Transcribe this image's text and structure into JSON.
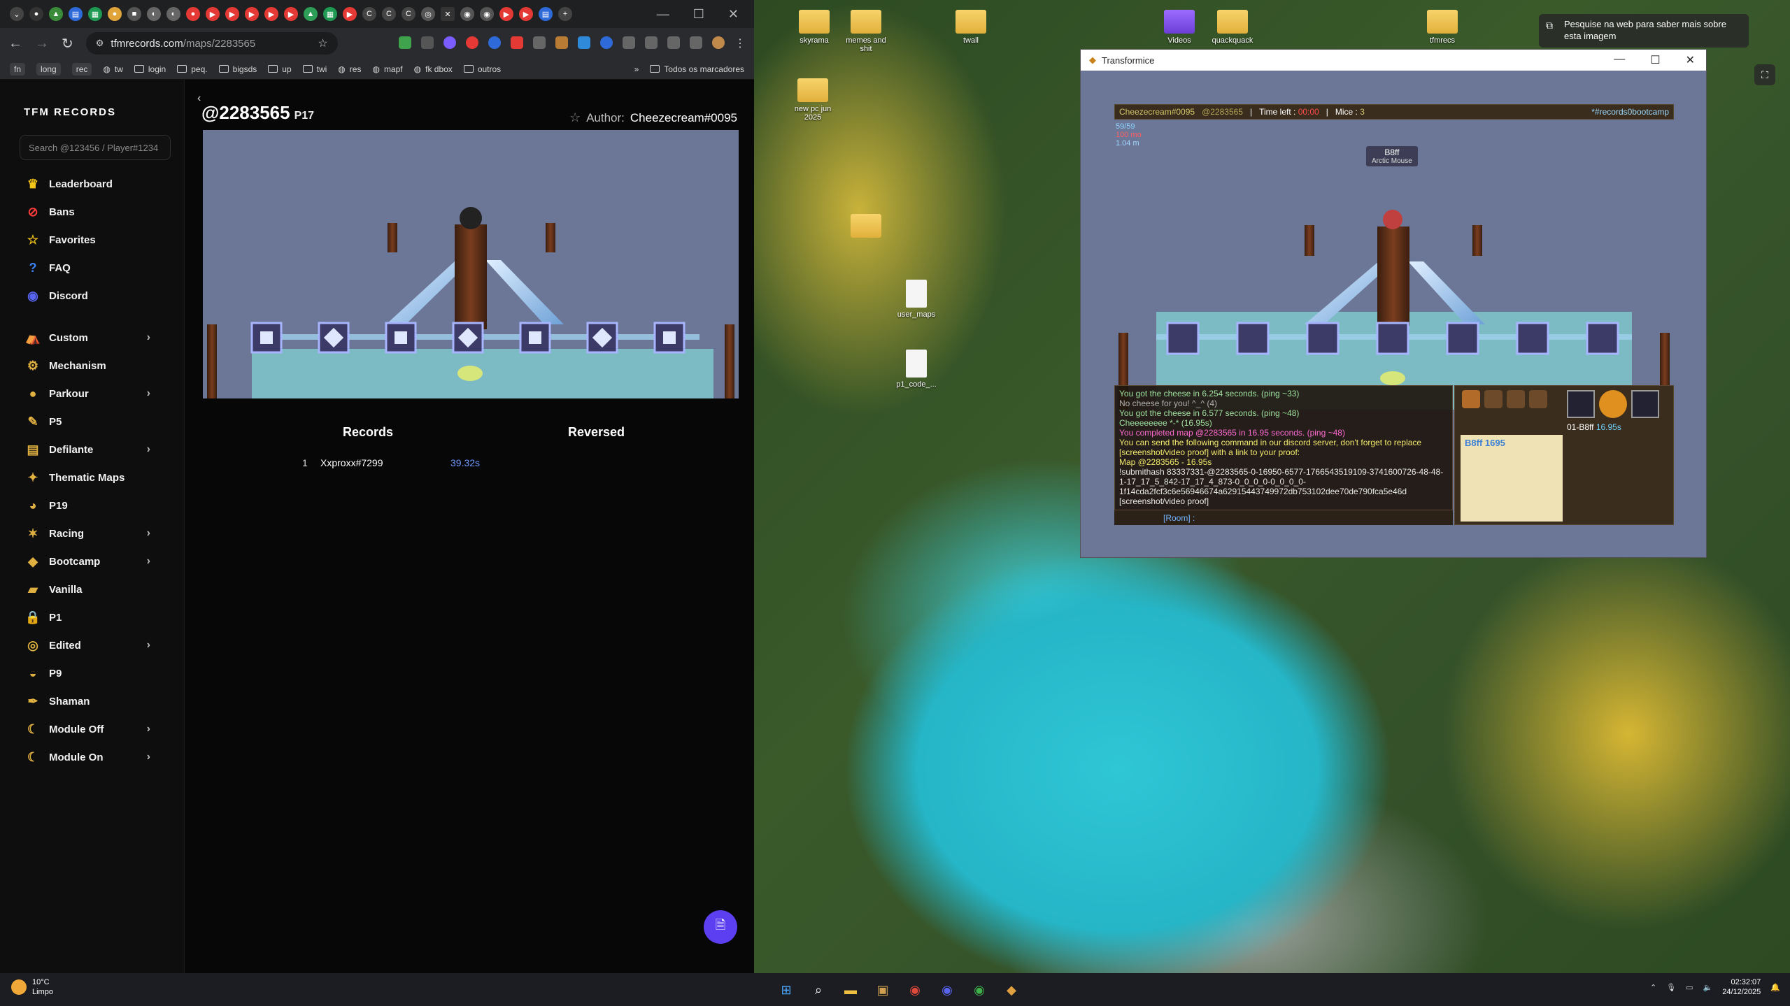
{
  "browser": {
    "url_host": "tfmrecords.com",
    "url_path": "/maps/2283565",
    "bookmarks": [
      {
        "label": "fn",
        "kind": "pill"
      },
      {
        "label": "long",
        "kind": "pill"
      },
      {
        "label": "rec",
        "kind": "pill"
      },
      {
        "label": "tw",
        "kind": "icon"
      },
      {
        "label": "login",
        "kind": "folder"
      },
      {
        "label": "peq.",
        "kind": "folder"
      },
      {
        "label": "bigsds",
        "kind": "folder"
      },
      {
        "label": "up",
        "kind": "folder"
      },
      {
        "label": "twi",
        "kind": "folder"
      },
      {
        "label": "res",
        "kind": "icon"
      },
      {
        "label": "mapf",
        "kind": "icon"
      },
      {
        "label": "fk dbox",
        "kind": "icon"
      },
      {
        "label": "outros",
        "kind": "folder"
      }
    ],
    "all_bookmarks": "Todos os marcadores"
  },
  "site": {
    "brand": "TFM RECORDS",
    "search_placeholder": "Search @123456 / Player#1234",
    "nav_top": [
      {
        "label": "Leaderboard",
        "icon": "crown-icon",
        "color": "#f5c518"
      },
      {
        "label": "Bans",
        "icon": "ban-icon",
        "color": "#ff3b3b"
      },
      {
        "label": "Favorites",
        "icon": "star-icon",
        "color": "#f5c518"
      },
      {
        "label": "FAQ",
        "icon": "question-icon",
        "color": "#3b82f6"
      },
      {
        "label": "Discord",
        "icon": "discord-icon",
        "color": "#5865f2"
      }
    ],
    "nav_categories": [
      {
        "label": "Custom",
        "icon": "tent-icon",
        "expand": true
      },
      {
        "label": "Mechanism",
        "icon": "gear-icon",
        "expand": false
      },
      {
        "label": "Parkour",
        "icon": "parkour-icon",
        "expand": true
      },
      {
        "label": "P5",
        "icon": "brush-icon",
        "expand": false
      },
      {
        "label": "Defilante",
        "icon": "defilante-icon",
        "expand": true
      },
      {
        "label": "Thematic Maps",
        "icon": "thematic-icon",
        "expand": false
      },
      {
        "label": "P19",
        "icon": "p19-icon",
        "expand": false
      },
      {
        "label": "Racing",
        "icon": "racing-icon",
        "expand": true
      },
      {
        "label": "Bootcamp",
        "icon": "bootcamp-icon",
        "expand": true
      },
      {
        "label": "Vanilla",
        "icon": "vanilla-icon",
        "expand": false
      },
      {
        "label": "P1",
        "icon": "lock-icon",
        "expand": false
      },
      {
        "label": "Edited",
        "icon": "edited-icon",
        "expand": true
      },
      {
        "label": "P9",
        "icon": "cheese-icon",
        "expand": false
      },
      {
        "label": "Shaman",
        "icon": "feather-icon",
        "expand": false
      },
      {
        "label": "Module Off",
        "icon": "moon-icon",
        "expand": true
      },
      {
        "label": "Module On",
        "icon": "moon-icon",
        "expand": true
      }
    ],
    "map": {
      "code": "@2283565",
      "category": "P17",
      "author_label": "Author:",
      "author": "Cheezecream#0095"
    },
    "records_heading": "Records",
    "reversed_heading": "Reversed",
    "records": [
      {
        "rank": "1",
        "player": "Xxproxx#7299",
        "time": "39.32s"
      }
    ]
  },
  "desktop": {
    "icons": [
      "skyrama",
      "memes and shit",
      "twall",
      "Videos",
      "quackquack",
      "tfmrecs",
      "new pc jun 2025",
      "user_maps",
      "p1_code_..."
    ],
    "win_tip": "Pesquise na web para saber mais sobre esta imagem"
  },
  "game": {
    "window_title": "Transformice",
    "player": "Cheezecream#0095",
    "map_code": "@2283565",
    "time_left_label": "Time left :",
    "time_left": "00:00",
    "mice_label": "Mice :",
    "mice": "3",
    "room": "*#records0bootcamp",
    "stats": [
      "59/59",
      "100 mo",
      "1.04 m"
    ],
    "mouse_name": "B8ff",
    "mouse_title": "Arctic Mouse",
    "chat": [
      {
        "text": "You got the cheese in 6.254 seconds. (ping ~33)",
        "cls": "g"
      },
      {
        "text": "No cheese for you! ^_^ (4)",
        "cls": "gr"
      },
      {
        "text": "You got the cheese in 6.577 seconds. (ping ~48)",
        "cls": "g"
      },
      {
        "text": "Cheeeeeeee *-* (16.95s)",
        "cls": "g"
      },
      {
        "text": "You completed map @2283565 in 16.95 seconds. (ping ~48)",
        "cls": "pk"
      },
      {
        "text": "You can send the following command in our discord server, don't forget to replace [screenshot/video proof] with a link to your proof:",
        "cls": "y"
      },
      {
        "text": "Map @2283565 - 16.95s",
        "cls": "y"
      },
      {
        "text": "!submithash 83337331-@2283565-0-16950-6577-1766543519109-3741600726-48-48-1-17_17_5_842-17_17_4_873-0_0_0_0-0_0_0_0-1f14cda2fcf3c6e56946674a62915443749972db753102dee70de790fca5e46d [screenshot/video proof]",
        "cls": ""
      }
    ],
    "chat_input": "[Room] :",
    "parchment": "B8ff 1695",
    "best": "01-B8ff",
    "best_time": "16.95s"
  },
  "taskbar": {
    "temp": "10°C",
    "weather": "Limpo",
    "time": "02:32:07",
    "date": "24/12/2025"
  }
}
